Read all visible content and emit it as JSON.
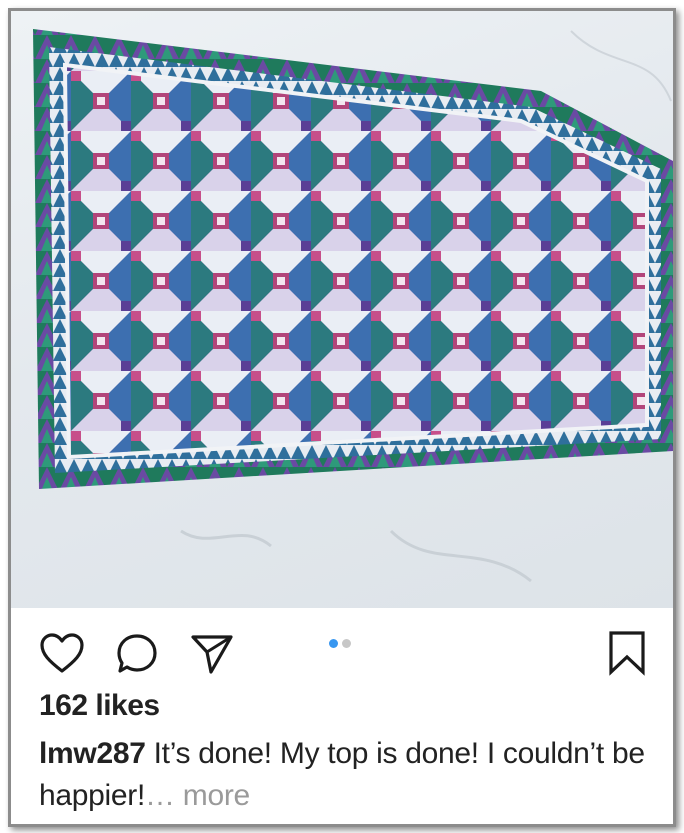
{
  "post": {
    "photo_icon": "quilt-photo",
    "likes_text": "162 likes",
    "username": "lmw287",
    "caption_text": " It’s done! My top is done! I couldn’t be happier!",
    "more_text": "… more"
  },
  "actions": {
    "like_icon": "heart-icon",
    "comment_icon": "comment-icon",
    "share_icon": "send-icon",
    "save_icon": "bookmark-icon"
  },
  "carousel": {
    "total": 2,
    "active_index": 0,
    "active_color": "#3897f0",
    "inactive_color": "#c7c7c7"
  }
}
